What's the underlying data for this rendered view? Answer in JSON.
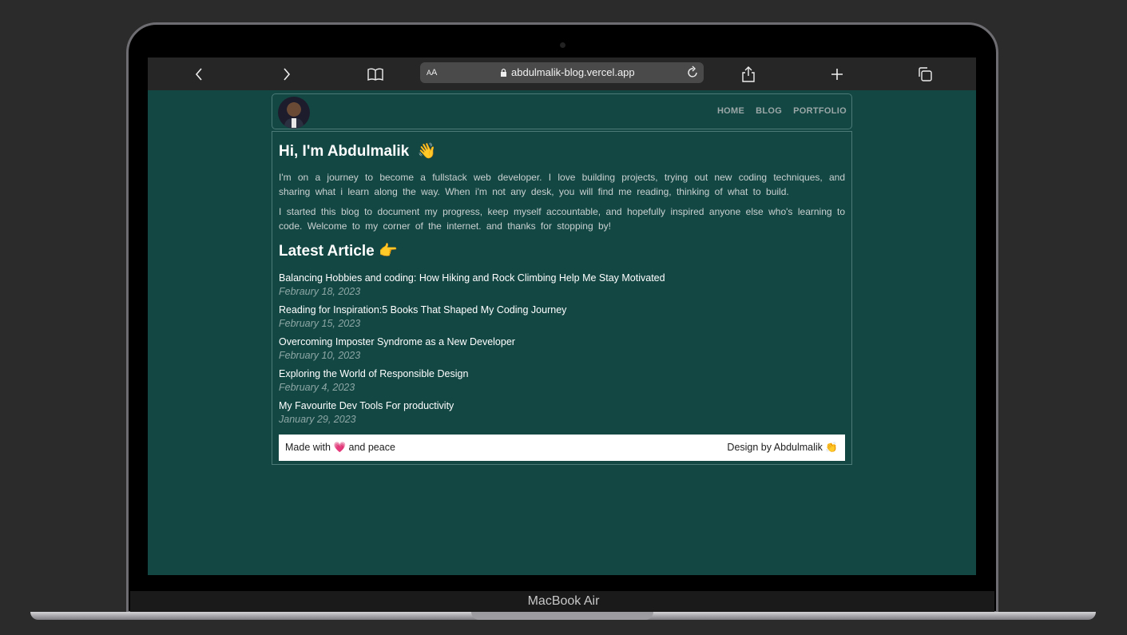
{
  "browser": {
    "text_size_label": "AA",
    "url": "abdulmalik-blog.vercel.app",
    "icons": [
      "back-icon",
      "forward-icon",
      "bookmarks-icon",
      "lock-icon",
      "reload-icon",
      "share-icon",
      "new-tab-icon",
      "tabs-icon"
    ]
  },
  "nav": {
    "items": [
      "HOME",
      "BLOG",
      "PORTFOLIO"
    ]
  },
  "intro": {
    "heading": "Hi, I'm Abdulmalik",
    "heading_emoji": "👋",
    "paragraph1": "I'm on a journey to become a fullstack web developer. I love building projects, trying out new coding techniques, and sharing what i learn along the way. When i'm not any desk, you will find me reading, thinking of what to build.",
    "paragraph2": "I started this blog to document my progress, keep myself accountable, and hopefully inspired anyone else who's learning to code. Welcome to my corner of the internet. and thanks for stopping by!"
  },
  "latest": {
    "heading": "Latest Article",
    "heading_emoji": "👉",
    "articles": [
      {
        "title": "Balancing Hobbies and coding: How Hiking and Rock Climbing Help Me Stay Motivated",
        "date": "Febraury 18, 2023"
      },
      {
        "title": "Reading for Inspiration:5 Books That Shaped My Coding Journey",
        "date": "February 15, 2023"
      },
      {
        "title": "Overcoming Imposter Syndrome as a New Developer",
        "date": "February 10, 2023"
      },
      {
        "title": "Exploring the World of Responsible Design",
        "date": "February 4, 2023"
      },
      {
        "title": "My Favourite Dev Tools For productivity",
        "date": "January 29, 2023"
      }
    ]
  },
  "footer": {
    "left_prefix": "Made with",
    "left_emoji": "💗",
    "left_suffix": "and peace",
    "right_text": "Design by Abdulmalik",
    "right_emoji": "👏"
  },
  "device": {
    "label": "MacBook Air"
  },
  "colors": {
    "page_bg": "#134744",
    "nav_text": "#9aa7a6",
    "date_text": "#8da7a5"
  }
}
